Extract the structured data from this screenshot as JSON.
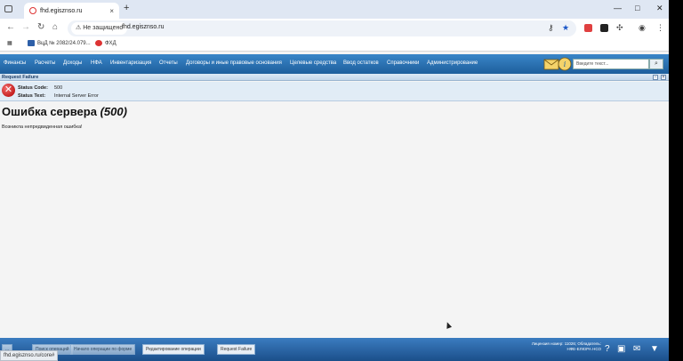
{
  "browser": {
    "tab_title": "fhd.egisznso.ru",
    "tab_close": "×",
    "new_tab": "+",
    "window_controls": [
      "—",
      "□",
      "✕"
    ],
    "security_label": "Не защищено",
    "url": "fhd.egisznso.ru",
    "bookmarks": [
      {
        "label": "ВцД № 2082/24.079...",
        "color": "#2d5fa8"
      },
      {
        "label": "ФХД",
        "color": "#d33"
      }
    ]
  },
  "app": {
    "menu": [
      "Финансы",
      "Расчеты",
      "Доходы",
      "НФА",
      "Инвентаризация",
      "Отчеты",
      "Договоры и иные правовые основания",
      "Целевые средства",
      "Ввод остатков",
      "Справочники",
      "Администрирование"
    ],
    "search_placeholder": "Введите текст...",
    "panel_title": "Request Failure",
    "status_code_label": "Status Code:",
    "status_code_value": "500",
    "status_text_label": "Status Text:",
    "status_text_value": "Internal Server Error",
    "error_title": "Ошибка сервера",
    "error_code": "(500)",
    "error_message": "Возникла непредвиденная ошибка!"
  },
  "bottom": {
    "tabs": [
      "...",
      "Поиск операций",
      "Начало операции по форме",
      "Редактирование операции",
      "Request Failure"
    ],
    "license_line1": "Лицензия номер: 11026; Обладатель:",
    "license_line2": "НФЕ-ЕЛЮРА НСО",
    "status_url": "fhd.egisznso.ru/core#"
  },
  "colors": {
    "menu_bar": "#1d5e9c",
    "error_red": "#b00000",
    "status_bg": "#e1ecf6"
  }
}
